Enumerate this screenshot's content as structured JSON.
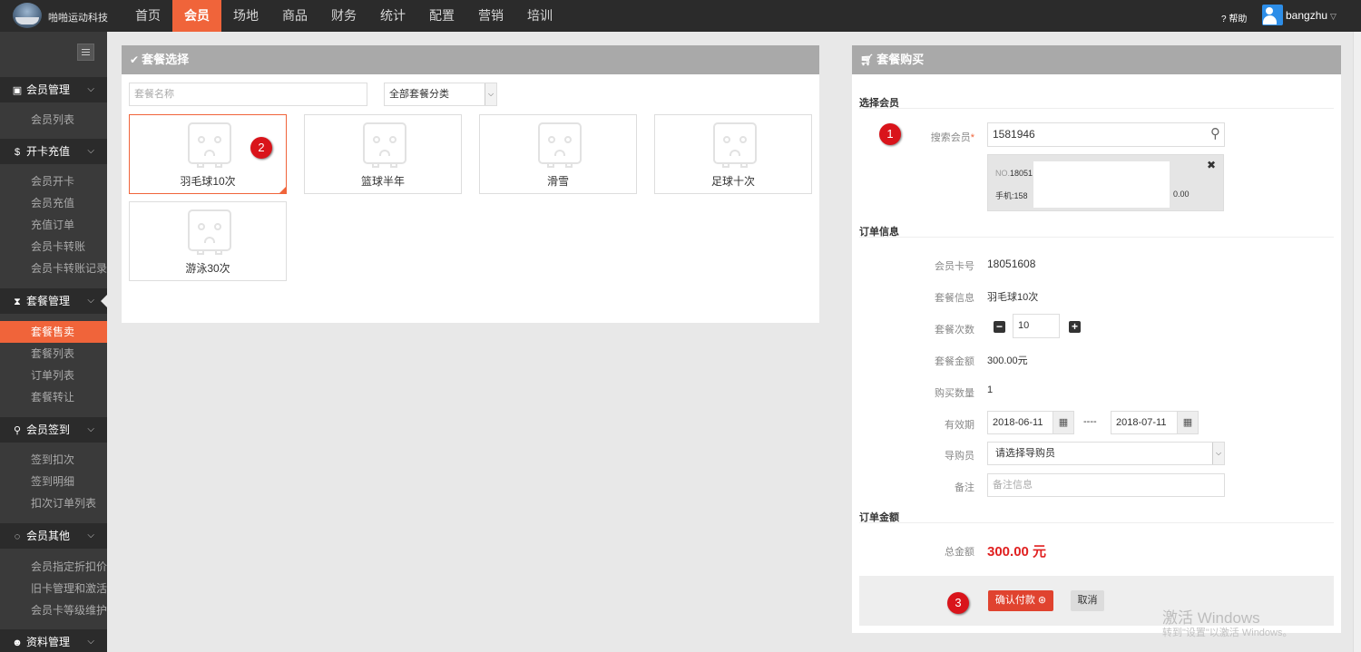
{
  "topbar": {
    "brand": "啪啪运动科技",
    "nav": [
      {
        "label": "首页"
      },
      {
        "label": "会员",
        "active": true
      },
      {
        "label": "场地"
      },
      {
        "label": "商品"
      },
      {
        "label": "财务"
      },
      {
        "label": "统计"
      },
      {
        "label": "配置"
      },
      {
        "label": "营销"
      },
      {
        "label": "培训"
      }
    ],
    "help": "帮助",
    "username": "bangzhu"
  },
  "sidebar": {
    "groups": [
      {
        "icon": "id-card-icon",
        "label": "会员管理",
        "items": [
          "会员列表"
        ]
      },
      {
        "icon": "dollar-icon",
        "label": "开卡充值",
        "items": [
          "会员开卡",
          "会员充值",
          "充值订单",
          "会员卡转账",
          "会员卡转账记录"
        ]
      },
      {
        "icon": "hourglass-icon",
        "label": "套餐管理",
        "items": [
          "套餐售卖",
          "套餐列表",
          "订单列表",
          "套餐转让"
        ],
        "active_item": 0
      },
      {
        "icon": "map-marker-icon",
        "label": "会员签到",
        "items": [
          "签到扣次",
          "签到明细",
          "扣次订单列表"
        ]
      },
      {
        "icon": "circle-notch-icon",
        "label": "会员其他",
        "items": [
          "会员指定折扣价",
          "旧卡管理和激活",
          "会员卡等级维护"
        ]
      },
      {
        "icon": "users-icon",
        "label": "资料管理",
        "items": []
      }
    ]
  },
  "package_select": {
    "title": "套餐选择",
    "search_placeholder": "套餐名称",
    "category_value": "全部套餐分类",
    "packages": [
      {
        "name": "羽毛球10次",
        "selected": true
      },
      {
        "name": "篮球半年"
      },
      {
        "name": "滑雪"
      },
      {
        "name": "足球十次"
      },
      {
        "name": "游泳30次"
      }
    ]
  },
  "purchase": {
    "title": "套餐购买",
    "section_member": "选择会员",
    "search_label": "搜索会员",
    "required_mark": "*",
    "search_value": "1581946",
    "member_card": {
      "no_label": "NO.",
      "no_value": "18051",
      "phone_label": "手机:",
      "phone_value": "158",
      "balance": "0.00"
    },
    "section_order": "订单信息",
    "card_no_label": "会员卡号",
    "card_no": "18051608",
    "package_info_label": "套餐信息",
    "package_info": "羽毛球10次",
    "count_label": "套餐次数",
    "count": "10",
    "amount_label": "套餐金额",
    "amount": "300.00元",
    "qty_label": "购买数量",
    "qty": "1",
    "valid_label": "有效期",
    "valid_from": "2018-06-11",
    "valid_sep": "----",
    "valid_to": "2018-07-11",
    "guide_label": "导购员",
    "guide_value": "请选择导购员",
    "remark_label": "备注",
    "remark_placeholder": "备注信息",
    "section_total": "订单金额",
    "total_label": "总金额",
    "total": "300.00 元",
    "confirm": "确认付款",
    "cancel": "取消"
  },
  "markers": [
    "1",
    "2",
    "3"
  ],
  "watermark": {
    "line1": "激活 Windows",
    "line2": "转到\"设置\"以激活 Windows。"
  },
  "colors": {
    "accent": "#f0643a",
    "topbar": "#2b2b2b",
    "sidebar": "#3a3a3a",
    "total_red": "#e02020"
  }
}
